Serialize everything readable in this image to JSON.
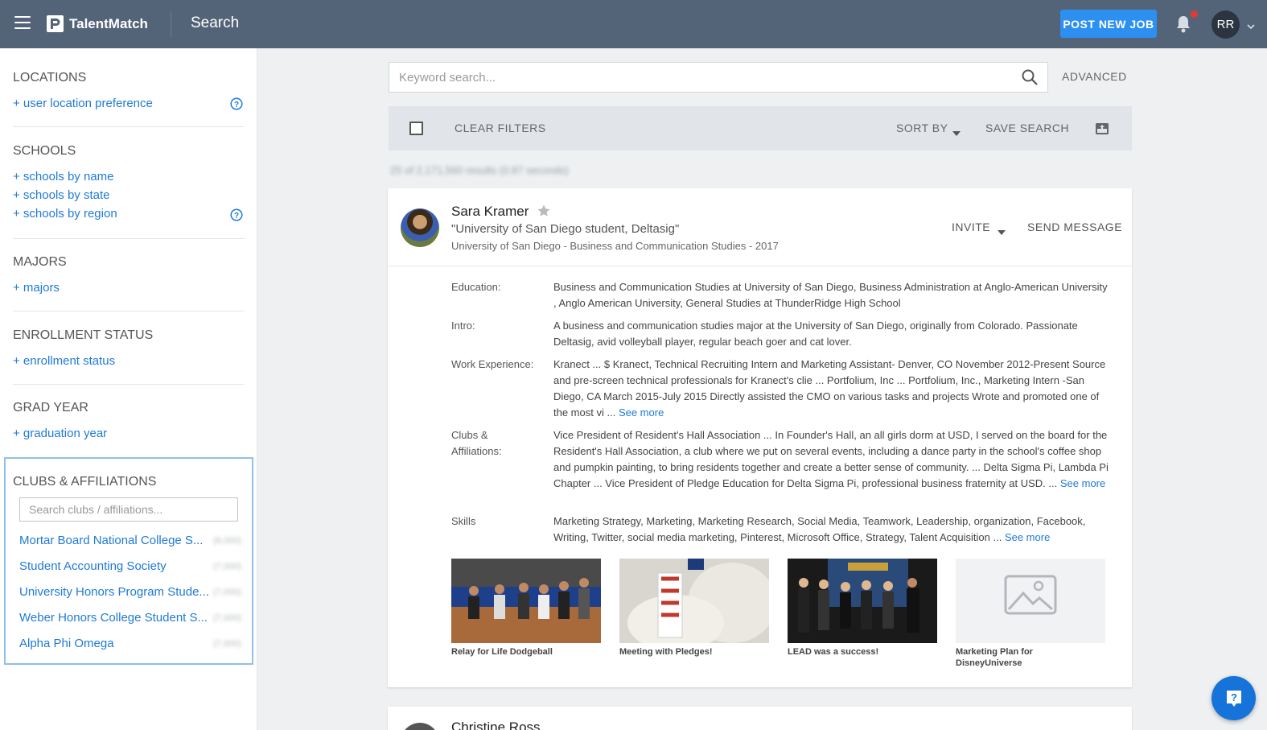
{
  "header": {
    "brand": "TalentMatch",
    "title": "Search",
    "post_job_label": "POST NEW JOB",
    "user_initials": "RR"
  },
  "sidebar": {
    "locations": {
      "heading": "LOCATIONS",
      "links": [
        "+ user location preference"
      ]
    },
    "schools": {
      "heading": "SCHOOLS",
      "links": [
        "+ schools by name",
        "+ schools by state",
        "+ schools by region"
      ]
    },
    "majors": {
      "heading": "MAJORS",
      "links": [
        "+ majors"
      ]
    },
    "enrollment": {
      "heading": "ENROLLMENT STATUS",
      "links": [
        "+ enrollment status"
      ]
    },
    "grad_year": {
      "heading": "GRAD YEAR",
      "links": [
        "+ graduation year"
      ]
    },
    "clubs": {
      "heading": "CLUBS & AFFILIATIONS",
      "search_placeholder": "Search clubs / affiliations...",
      "items": [
        {
          "name": "Mortar Board National College S...",
          "count": "(8,000)"
        },
        {
          "name": "Student Accounting Society",
          "count": "(7,000)"
        },
        {
          "name": "University Honors Program Stude...",
          "count": "(7,000)"
        },
        {
          "name": "Weber Honors College Student S...",
          "count": "(7,000)"
        },
        {
          "name": "Alpha Phi Omega",
          "count": "(7,000)"
        }
      ]
    }
  },
  "search": {
    "placeholder": "Keyword search...",
    "advanced_label": "ADVANCED"
  },
  "filters": {
    "clear_label": "CLEAR FILTERS",
    "sort_label": "SORT BY",
    "save_label": "SAVE SEARCH"
  },
  "results_count": "25 of 2,171,560 results (0.87 seconds)",
  "profile": {
    "name": "Sara Kramer",
    "headline": "\"University of San Diego student, Deltasig\"",
    "school_line": "University of San Diego - Business and Communication Studies - 2017",
    "invite_label": "INVITE",
    "message_label": "SEND MESSAGE",
    "see_more": "See more",
    "details": [
      {
        "label": "Education:",
        "value": "Business and Communication Studies at University of San Diego, Business Administration at Anglo-American University , Anglo American University, General Studies at ThunderRidge High School"
      },
      {
        "label": "Intro:",
        "value": "A business and communication studies major at the University of San Diego, originally from Colorado. Passionate Deltasig, avid volleyball player, regular beach goer and cat lover."
      },
      {
        "label": "Work Experience:",
        "value": "Kranect ... $ Kranect, Technical Recruiting Intern and Marketing Assistant- Denver, CO November 2012-Present Source and pre-screen technical professionals for Kranect's clie ... Portfolium, Inc ... Portfolium, Inc., Marketing Intern -San Diego, CA March 2015-July 2015 Directly assisted the CMO on various tasks and projects Wrote and promoted one of the most vi ..."
      },
      {
        "label": "Clubs & Affiliations:",
        "value": "Vice President of Resident's Hall Association ... In Founder's Hall, an all girls dorm at USD, I served on the board for the Resident's Hall Association, a club where we put on several events, including a dance party in the school's coffee shop and pumpkin painting, to bring residents together and create a better sense of community. ... Delta Sigma Pi, Lambda Pi Chapter ... Vice President of Pledge Education for Delta Sigma Pi, professional business fraternity at USD. ..."
      },
      {
        "label": "Skills",
        "value": "Marketing Strategy, Marketing, Marketing Research, Social Media, Teamwork, Leadership, organization, Facebook, Writing, Twitter, social media marketing, Pinterest, Microsoft Office, Strategy, Talent Acquisition ..."
      }
    ],
    "portfolio": [
      {
        "caption": "Relay for Life Dodgeball"
      },
      {
        "caption": "Meeting with Pledges!"
      },
      {
        "caption": "LEAD was a success!"
      },
      {
        "caption": "Marketing Plan for DisneyUniverse"
      }
    ]
  },
  "next_profile": {
    "name": "Christine Ross"
  }
}
